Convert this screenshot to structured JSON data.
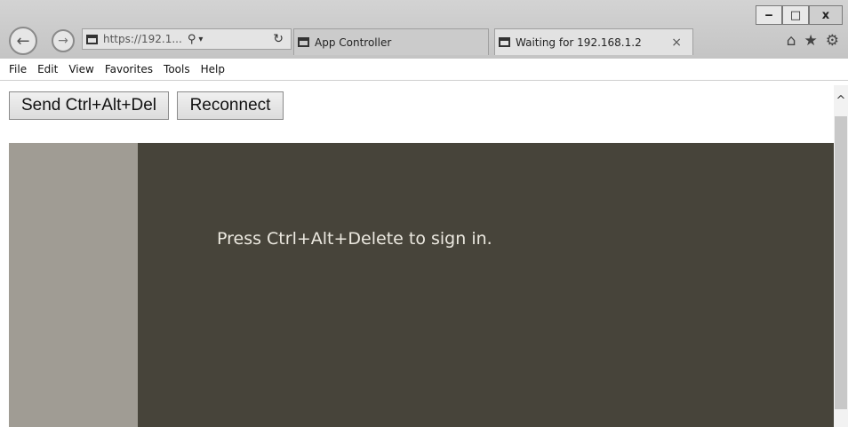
{
  "browser": {
    "address": {
      "text": "https://192.1...",
      "search_glyph": "⚲",
      "dropdown_glyph": "▾",
      "refresh_glyph": "↻"
    },
    "tabs": [
      {
        "label": "App Controller",
        "active": false
      },
      {
        "label": "Waiting for 192.168.1.2",
        "active": true,
        "close_glyph": "×"
      }
    ],
    "window_controls": {
      "minimize": "‒",
      "maximize": "□",
      "close": "x"
    },
    "tool_icons": {
      "home": "⌂",
      "favorites": "★",
      "settings": "⚙"
    },
    "nav": {
      "back": "←",
      "forward": "→"
    }
  },
  "menu": [
    "File",
    "Edit",
    "View",
    "Favorites",
    "Tools",
    "Help"
  ],
  "toolbar": {
    "send_cad_label": "Send Ctrl+Alt+Del",
    "reconnect_label": "Reconnect"
  },
  "remote": {
    "message": "Press Ctrl+Alt+Delete to sign in.",
    "background_color": "#47443a",
    "side_panel_color": "#a09c94"
  },
  "scrollbar": {
    "up_glyph": "^"
  }
}
